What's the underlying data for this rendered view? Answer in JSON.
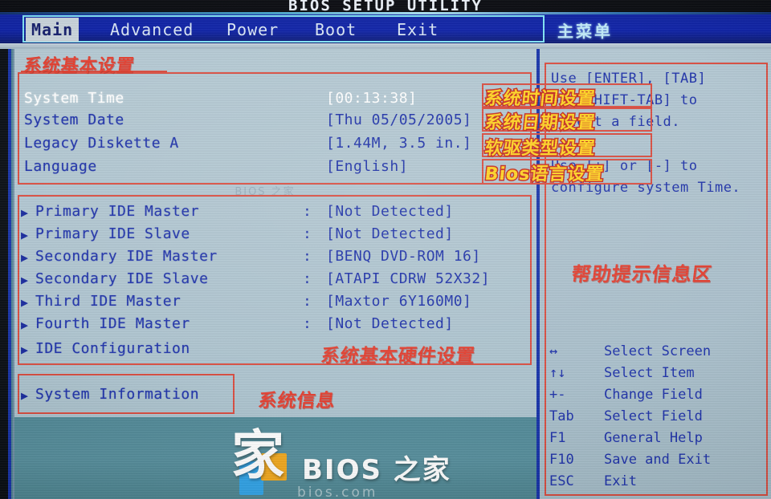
{
  "window": {
    "title": "BIOS SETUP UTILITY"
  },
  "menubar": {
    "tabs": [
      {
        "label": "Main",
        "active": true
      },
      {
        "label": "Advanced",
        "active": false
      },
      {
        "label": "Power",
        "active": false
      },
      {
        "label": "Boot",
        "active": false
      },
      {
        "label": "Exit",
        "active": false
      }
    ],
    "annotation_main_menu": "主菜单"
  },
  "main": {
    "group_basic": {
      "annotation": "系统基本设置",
      "rows": [
        {
          "label": "System Time",
          "value": "[00:13:38]",
          "highlighted": true,
          "annotation": "系统时间设置"
        },
        {
          "label": "System Date",
          "value": "[Thu 05/05/2005]",
          "highlighted": false,
          "annotation": "系统日期设置"
        },
        {
          "label": "Legacy Diskette A",
          "value": "[1.44M, 3.5 in.]",
          "highlighted": false,
          "annotation": "软驱类型设置"
        },
        {
          "label": "Language",
          "value": "[English]",
          "highlighted": false,
          "annotation": "Bios语言设置"
        }
      ]
    },
    "group_ide": {
      "annotation": "系统基本硬件设置",
      "rows": [
        {
          "label": "Primary IDE Master",
          "colon": ":",
          "value": "[Not Detected]"
        },
        {
          "label": "Primary IDE Slave",
          "colon": ":",
          "value": "[Not Detected]"
        },
        {
          "label": "Secondary IDE Master",
          "colon": ":",
          "value": "[BENQ    DVD-ROM 16]"
        },
        {
          "label": "Secondary IDE Slave",
          "colon": ":",
          "value": "[ATAPI   CDRW 52X32]"
        },
        {
          "label": "Third IDE Master",
          "colon": ":",
          "value": "[Maxtor 6Y160M0]"
        },
        {
          "label": "Fourth IDE Master",
          "colon": ":",
          "value": "[Not Detected]"
        },
        {
          "label": "IDE Configuration",
          "colon": "",
          "value": ""
        }
      ]
    },
    "group_sysinfo": {
      "annotation": "系统信息",
      "rows": [
        {
          "label": "System Information"
        }
      ]
    }
  },
  "help": {
    "annotation": "帮助提示信息区",
    "lines": [
      "Use [ENTER], [TAB]",
      "or [SHIFT-TAB] to",
      "select a field.",
      "",
      "Use [+] or [-] to",
      "configure system Time."
    ],
    "keys": [
      {
        "sym": "↔",
        "desc": "Select Screen"
      },
      {
        "sym": "↑↓",
        "desc": "Select Item"
      },
      {
        "sym": "+-",
        "desc": "Change Field"
      },
      {
        "sym": "Tab",
        "desc": "Select Field"
      },
      {
        "sym": "F1",
        "desc": "General Help"
      },
      {
        "sym": "F10",
        "desc": "Save and Exit"
      },
      {
        "sym": "ESC",
        "desc": "Exit"
      }
    ]
  },
  "watermark": {
    "logo_glyph": "家",
    "text": "BIOS 之家",
    "subtitle": "bios.com"
  },
  "faint_center_text": "BIOS 之家",
  "colors": {
    "menubar_blue": "#0b1fa0",
    "panel_bg": "#aec4cf",
    "bios_text_blue": "#1b2fa8",
    "annotation_red": "#e23c2d",
    "annotation_yellow": "#ffd21e",
    "highlight_white": "#ffffff",
    "accent_cyan": "#7fe4f4"
  }
}
